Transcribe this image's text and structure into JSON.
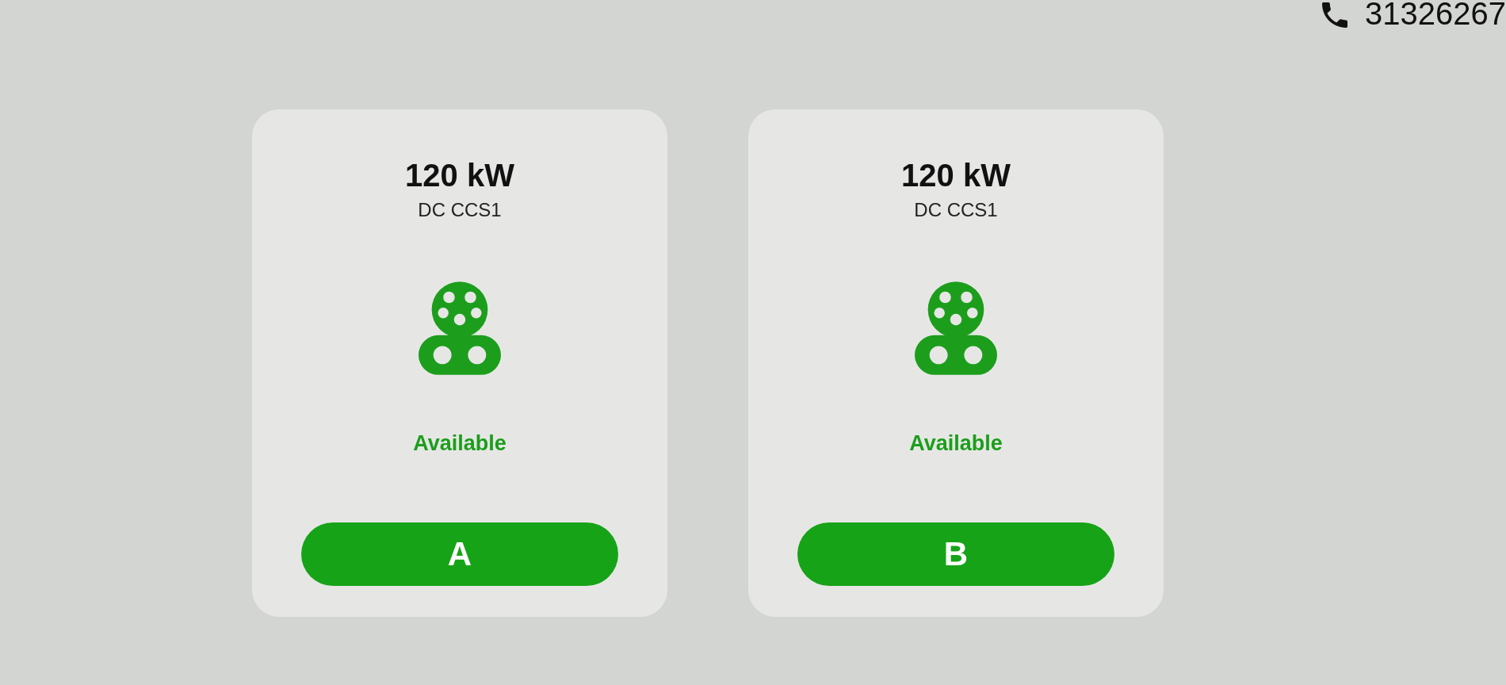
{
  "header": {
    "phone_number": "31326267"
  },
  "connectors": [
    {
      "power": "120 kW",
      "plug_type": "DC CCS1",
      "status": "Available",
      "available": true,
      "button_label": "A"
    },
    {
      "power": "120 kW",
      "plug_type": "DC CCS1",
      "status": "Available",
      "available": true,
      "button_label": "B"
    }
  ]
}
